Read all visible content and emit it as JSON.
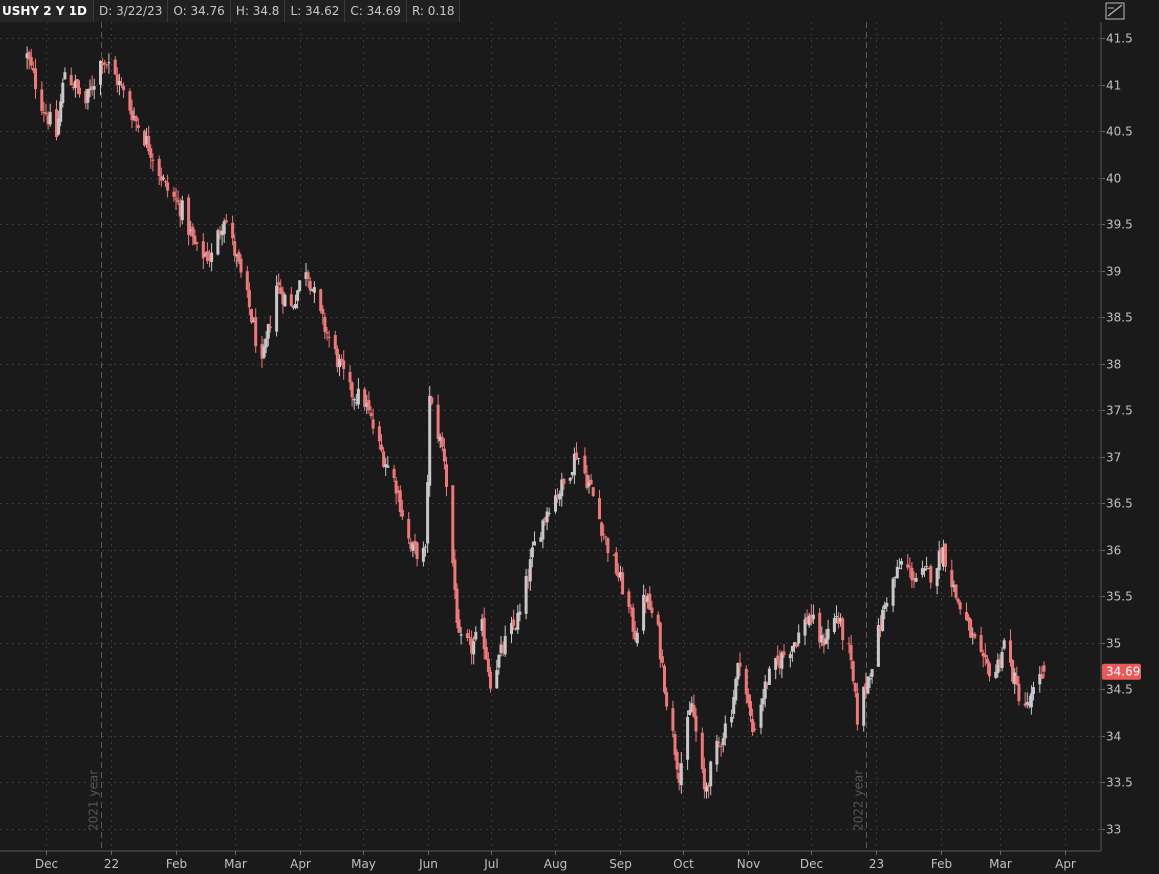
{
  "header": {
    "symbol": "USHY 2 Y 1D",
    "date": "D: 3/22/23",
    "open": "O: 34.76",
    "high": "H: 34.8",
    "low": "L: 34.62",
    "close": "C: 34.69",
    "range": "R: 0.18",
    "draw_tool_icon": "drawing-tool-icon"
  },
  "colors": {
    "background": "#1a1a1a",
    "grid": "#3a3a3a",
    "up_candle": "#c8c8c8",
    "down_candle": "#f07878",
    "last_price_badge": "#e85a5a"
  },
  "chart_data": {
    "type": "candlestick",
    "title": "",
    "xlabel": "",
    "ylabel": "",
    "ylim": [
      32.88,
      41.65
    ],
    "y_ticks": [
      33,
      33.5,
      34,
      34.5,
      35,
      35.5,
      36,
      36.5,
      37,
      37.5,
      38,
      38.5,
      39,
      39.5,
      40,
      40.5,
      41,
      41.5
    ],
    "y_tick_labels": [
      "33",
      "33.5",
      "34",
      "34.5",
      "35",
      "35.5",
      "36",
      "36.5",
      "37",
      "37.5",
      "38",
      "38.5",
      "39",
      "39.5",
      "40",
      "40.5",
      "41",
      "41.5"
    ],
    "x_tick_labels": [
      {
        "label": "Dec",
        "date": "2021-12-01"
      },
      {
        "label": "22",
        "date": "2022-01-01"
      },
      {
        "label": "Feb",
        "date": "2022-02-01"
      },
      {
        "label": "Mar",
        "date": "2022-03-01"
      },
      {
        "label": "Apr",
        "date": "2022-04-01"
      },
      {
        "label": "May",
        "date": "2022-05-01"
      },
      {
        "label": "Jun",
        "date": "2022-06-01"
      },
      {
        "label": "Jul",
        "date": "2022-07-01"
      },
      {
        "label": "Aug",
        "date": "2022-08-01"
      },
      {
        "label": "Sep",
        "date": "2022-09-01"
      },
      {
        "label": "Oct",
        "date": "2022-10-01"
      },
      {
        "label": "Nov",
        "date": "2022-11-01"
      },
      {
        "label": "Dec",
        "date": "2022-12-01"
      },
      {
        "label": "23",
        "date": "2023-01-01"
      },
      {
        "label": "Feb",
        "date": "2023-02-01"
      },
      {
        "label": "Mar",
        "date": "2023-03-01"
      },
      {
        "label": "Apr",
        "date": "2023-04-01"
      }
    ],
    "year_markers": [
      {
        "label": "2021 year",
        "date": "2021-12-27"
      },
      {
        "label": "2022 year",
        "date": "2022-12-27"
      }
    ],
    "grid": true,
    "last_price": 34.69,
    "last_price_label": "34.69",
    "price_path": [
      [
        "2021-11-22",
        41.3
      ],
      [
        "2021-11-29",
        40.8
      ],
      [
        "2021-12-06",
        40.45
      ],
      [
        "2021-12-10",
        41.15
      ],
      [
        "2021-12-20",
        40.8
      ],
      [
        "2021-12-28",
        41.3
      ],
      [
        "2022-01-04",
        41.05
      ],
      [
        "2022-01-11",
        40.7
      ],
      [
        "2022-01-20",
        40.3
      ],
      [
        "2022-01-27",
        39.9
      ],
      [
        "2022-02-04",
        39.65
      ],
      [
        "2022-02-11",
        39.2
      ],
      [
        "2022-02-18",
        39.15
      ],
      [
        "2022-02-24",
        39.6
      ],
      [
        "2022-03-01",
        39.2
      ],
      [
        "2022-03-08",
        38.6
      ],
      [
        "2022-03-14",
        37.95
      ],
      [
        "2022-03-21",
        38.85
      ],
      [
        "2022-03-28",
        38.6
      ],
      [
        "2022-04-04",
        39.05
      ],
      [
        "2022-04-11",
        38.5
      ],
      [
        "2022-04-18",
        38.1
      ],
      [
        "2022-04-25",
        37.7
      ],
      [
        "2022-05-02",
        37.6
      ],
      [
        "2022-05-09",
        37.1
      ],
      [
        "2022-05-17",
        36.7
      ],
      [
        "2022-05-24",
        36.0
      ],
      [
        "2022-05-31",
        35.95
      ],
      [
        "2022-06-02",
        37.6
      ],
      [
        "2022-06-09",
        37.0
      ],
      [
        "2022-06-16",
        35.0
      ],
      [
        "2022-06-22",
        34.95
      ],
      [
        "2022-06-27",
        35.15
      ],
      [
        "2022-07-01",
        34.6
      ],
      [
        "2022-07-08",
        35.0
      ],
      [
        "2022-07-15",
        35.3
      ],
      [
        "2022-07-22",
        36.05
      ],
      [
        "2022-07-29",
        36.5
      ],
      [
        "2022-08-05",
        36.7
      ],
      [
        "2022-08-11",
        37.05
      ],
      [
        "2022-08-18",
        36.65
      ],
      [
        "2022-08-25",
        36.1
      ],
      [
        "2022-09-02",
        35.6
      ],
      [
        "2022-09-08",
        35.1
      ],
      [
        "2022-09-13",
        35.5
      ],
      [
        "2022-09-19",
        35.1
      ],
      [
        "2022-09-23",
        34.4
      ],
      [
        "2022-09-29",
        33.6
      ],
      [
        "2022-10-05",
        34.35
      ],
      [
        "2022-10-11",
        33.4
      ],
      [
        "2022-10-17",
        33.85
      ],
      [
        "2022-10-24",
        34.3
      ],
      [
        "2022-10-28",
        34.85
      ],
      [
        "2022-11-03",
        34.05
      ],
      [
        "2022-11-10",
        34.6
      ],
      [
        "2022-11-17",
        34.85
      ],
      [
        "2022-11-24",
        35.05
      ],
      [
        "2022-11-30",
        35.3
      ],
      [
        "2022-12-06",
        35.0
      ],
      [
        "2022-12-13",
        35.3
      ],
      [
        "2022-12-19",
        34.9
      ],
      [
        "2022-12-23",
        34.2
      ],
      [
        "2022-12-30",
        34.8
      ],
      [
        "2023-01-06",
        35.5
      ],
      [
        "2023-01-13",
        35.85
      ],
      [
        "2023-01-20",
        35.7
      ],
      [
        "2023-01-27",
        35.75
      ],
      [
        "2023-02-02",
        36.0
      ],
      [
        "2023-02-08",
        35.5
      ],
      [
        "2023-02-15",
        35.1
      ],
      [
        "2023-02-21",
        34.75
      ],
      [
        "2023-02-27",
        34.7
      ],
      [
        "2023-03-03",
        35.0
      ],
      [
        "2023-03-09",
        34.5
      ],
      [
        "2023-03-14",
        34.3
      ],
      [
        "2023-03-22",
        34.69
      ]
    ]
  }
}
